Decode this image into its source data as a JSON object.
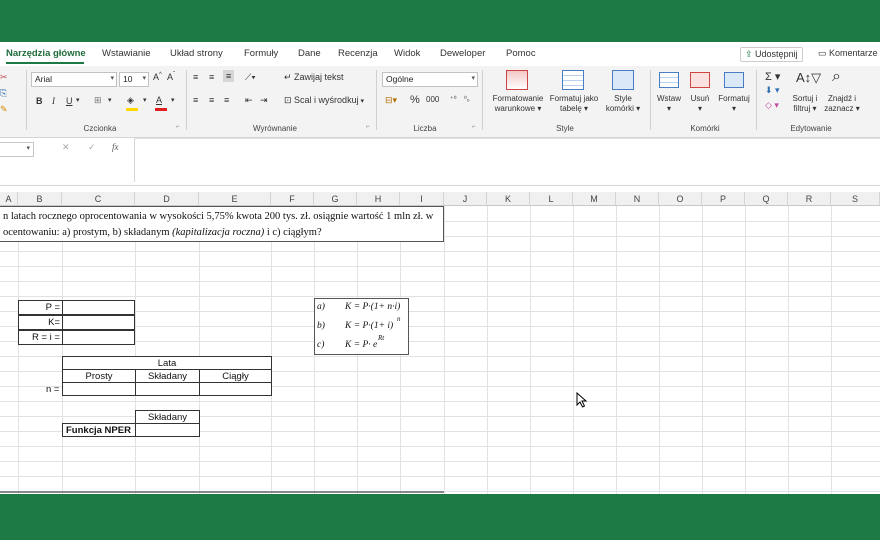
{
  "tabs": [
    "Narzędzia główne",
    "Wstawianie",
    "Układ strony",
    "Formuły",
    "Dane",
    "Recenzja",
    "Widok",
    "Deweloper",
    "Pomoc"
  ],
  "share_label": "Udostępnij",
  "comments_label": "Komentarze",
  "ribbon": {
    "font_name": "Arial",
    "font_size": "10",
    "wrap_text": "Zawijaj tekst",
    "merge_center": "Scal i wyśrodkuj",
    "number_format": "Ogólne",
    "cond_format": [
      "Formatowanie",
      "warunkowe"
    ],
    "format_table": [
      "Formatuj jako",
      "tabelę"
    ],
    "cell_styles": [
      "Style",
      "komórki"
    ],
    "insert": "Wstaw",
    "delete": "Usuń",
    "format": "Formatuj",
    "sort_filter": [
      "Sortuj i",
      "filtruj"
    ],
    "find_select": [
      "Znajdź i",
      "zaznacz"
    ],
    "groups": {
      "czcionka": "Czcionka",
      "wyrownanie": "Wyrównanie",
      "liczba": "Liczba",
      "style": "Style",
      "komorki": "Komórki",
      "edytowanie": "Edytowanie"
    }
  },
  "formula_bar": {
    "fx": "fx"
  },
  "columns": [
    "A",
    "B",
    "C",
    "D",
    "E",
    "F",
    "G",
    "H",
    "I",
    "J",
    "K",
    "L",
    "M",
    "N",
    "O",
    "P",
    "Q",
    "R",
    "S"
  ],
  "problem": {
    "line1": "n latach rocznego oprocentowania w wysokości 5,75% kwota 200 tys. zł. osiągnie wartość 1 mln zł. w",
    "line2_a": "ocentowaniu: a) prostym, b) składanym ",
    "line2_italic": "(kapitalizacja roczna)",
    "line2_b": "  i c) ciągłym?"
  },
  "labels": {
    "P": "P =",
    "K": "K=",
    "R": "R = i ="
  },
  "formulas": {
    "a_label": "a)",
    "a_formula": "K = P·(1+ n·i)",
    "b_label": "b)",
    "b_formula": "K = P·(1+ i)",
    "b_exp": "n",
    "c_label": "c)",
    "c_formula": "K = P· e",
    "c_exp": "Rt"
  },
  "years_table": {
    "title": "Lata",
    "headers": [
      "Prosty",
      "Składany",
      "Ciągły"
    ],
    "row_label": "n ="
  },
  "nper_table": {
    "header": "Składany",
    "label": "Funkcja NPER"
  }
}
